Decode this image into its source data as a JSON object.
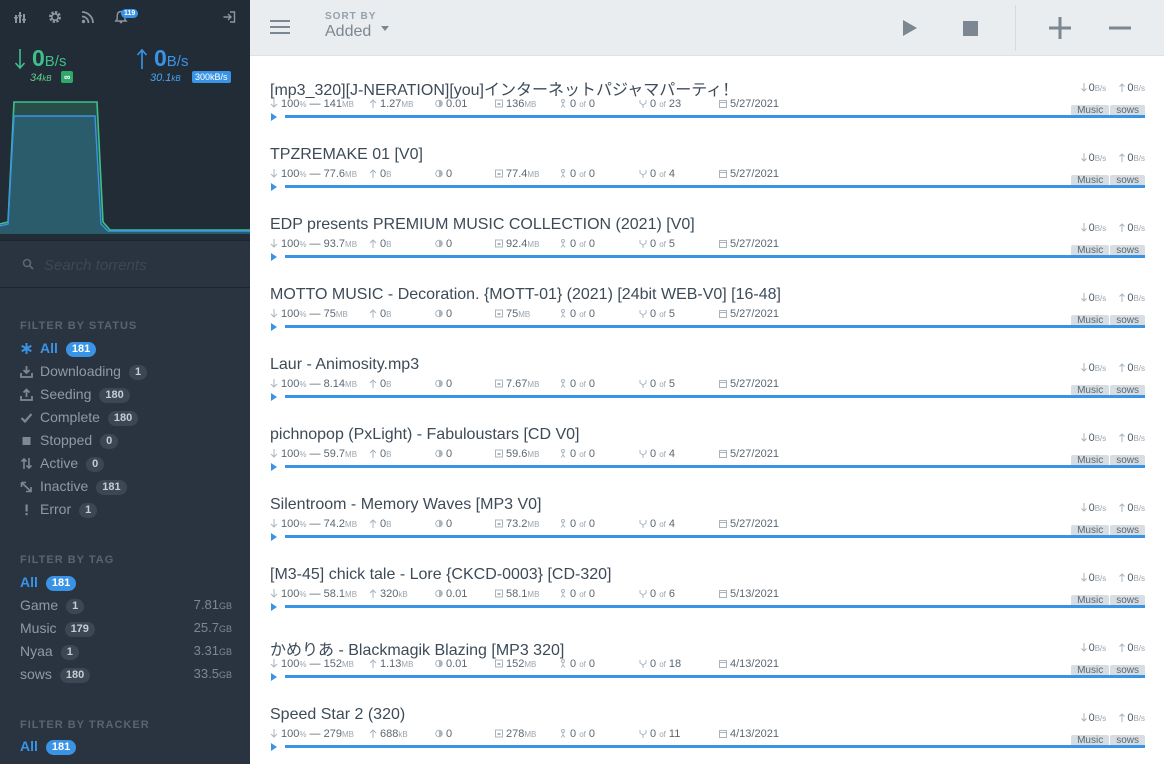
{
  "sidebar": {
    "icons": [
      "stats-icon",
      "settings-icon",
      "feed-icon",
      "notifications-icon",
      "logout-icon"
    ],
    "notification_count": "119",
    "download": {
      "value": "0",
      "unit": "B/s",
      "total": "34",
      "total_unit": "kB",
      "limit": "∞"
    },
    "upload": {
      "value": "0",
      "unit": "B/s",
      "total": "30.1",
      "total_unit": "kB",
      "limit": "300kB/s"
    },
    "search_placeholder": "Search torrents",
    "status_heading": "FILTER BY STATUS",
    "statuses": [
      {
        "label": "All",
        "count": "181",
        "icon": "asterisk-icon",
        "active": true
      },
      {
        "label": "Downloading",
        "count": "1",
        "icon": "download-icon",
        "active": false
      },
      {
        "label": "Seeding",
        "count": "180",
        "icon": "upload-icon",
        "active": false
      },
      {
        "label": "Complete",
        "count": "180",
        "icon": "check-icon",
        "active": false
      },
      {
        "label": "Stopped",
        "count": "0",
        "icon": "stop-icon",
        "active": false
      },
      {
        "label": "Active",
        "count": "0",
        "icon": "swap-icon",
        "active": false
      },
      {
        "label": "Inactive",
        "count": "181",
        "icon": "inactive-icon",
        "active": false
      },
      {
        "label": "Error",
        "count": "1",
        "icon": "exclamation-icon",
        "active": false
      }
    ],
    "tag_heading": "FILTER BY TAG",
    "tags": [
      {
        "label": "All",
        "count": "181",
        "size": "",
        "unit": "",
        "active": true
      },
      {
        "label": "Game",
        "count": "1",
        "size": "7.81",
        "unit": "GB",
        "active": false
      },
      {
        "label": "Music",
        "count": "179",
        "size": "25.7",
        "unit": "GB",
        "active": false
      },
      {
        "label": "Nyaa",
        "count": "1",
        "size": "3.31",
        "unit": "GB",
        "active": false
      },
      {
        "label": "sows",
        "count": "180",
        "size": "33.5",
        "unit": "GB",
        "active": false
      }
    ],
    "tracker_heading": "FILTER BY TRACKER",
    "trackers": [
      {
        "label": "All",
        "count": "181",
        "active": true
      }
    ]
  },
  "toolbar": {
    "sort_label": "SORT BY",
    "sort_value": "Added",
    "icons": [
      "menu-icon",
      "start-icon",
      "stop-icon",
      "add-icon",
      "remove-icon"
    ]
  },
  "colors": {
    "accent": "#3a94e6",
    "download": "#3fbf8a",
    "sidebar": "#2a3440"
  },
  "torrents": [
    {
      "name": "[mp3_320][J-NERATION][you]インターネットパジャマパーティ！",
      "percent": "100",
      "size": "141",
      "size_unit": "MB",
      "uploaded": "1.27",
      "uploaded_unit": "MB",
      "ratio": "0.01",
      "downloaded": "136",
      "downloaded_unit": "MB",
      "peers": "0",
      "peers_of": "0",
      "seeds": "0",
      "seeds_of": "23",
      "date": "5/27/2021",
      "dl_rate": "0",
      "ul_rate": "0",
      "rate_unit": "B/s",
      "tags": [
        "Music",
        "sows"
      ],
      "progress": 100
    },
    {
      "name": "TPZREMAKE 01 [V0]",
      "percent": "100",
      "size": "77.6",
      "size_unit": "MB",
      "uploaded": "0",
      "uploaded_unit": "B",
      "ratio": "0",
      "downloaded": "77.4",
      "downloaded_unit": "MB",
      "peers": "0",
      "peers_of": "0",
      "seeds": "0",
      "seeds_of": "4",
      "date": "5/27/2021",
      "dl_rate": "0",
      "ul_rate": "0",
      "rate_unit": "B/s",
      "tags": [
        "Music",
        "sows"
      ],
      "progress": 100
    },
    {
      "name": "EDP presents PREMIUM MUSIC COLLECTION (2021) [V0]",
      "percent": "100",
      "size": "93.7",
      "size_unit": "MB",
      "uploaded": "0",
      "uploaded_unit": "B",
      "ratio": "0",
      "downloaded": "92.4",
      "downloaded_unit": "MB",
      "peers": "0",
      "peers_of": "0",
      "seeds": "0",
      "seeds_of": "5",
      "date": "5/27/2021",
      "dl_rate": "0",
      "ul_rate": "0",
      "rate_unit": "B/s",
      "tags": [
        "Music",
        "sows"
      ],
      "progress": 100
    },
    {
      "name": "MOTTO MUSIC - Decoration. {MOTT-01} (2021) [24bit WEB-V0] [16-48]",
      "percent": "100",
      "size": "75",
      "size_unit": "MB",
      "uploaded": "0",
      "uploaded_unit": "B",
      "ratio": "0",
      "downloaded": "75",
      "downloaded_unit": "MB",
      "peers": "0",
      "peers_of": "0",
      "seeds": "0",
      "seeds_of": "5",
      "date": "5/27/2021",
      "dl_rate": "0",
      "ul_rate": "0",
      "rate_unit": "B/s",
      "tags": [
        "Music",
        "sows"
      ],
      "progress": 100
    },
    {
      "name": "Laur - Animosity.mp3",
      "percent": "100",
      "size": "8.14",
      "size_unit": "MB",
      "uploaded": "0",
      "uploaded_unit": "B",
      "ratio": "0",
      "downloaded": "7.67",
      "downloaded_unit": "MB",
      "peers": "0",
      "peers_of": "0",
      "seeds": "0",
      "seeds_of": "5",
      "date": "5/27/2021",
      "dl_rate": "0",
      "ul_rate": "0",
      "rate_unit": "B/s",
      "tags": [
        "Music",
        "sows"
      ],
      "progress": 100
    },
    {
      "name": "pichnopop (PxLight) - Fabuloustars [CD V0]",
      "percent": "100",
      "size": "59.7",
      "size_unit": "MB",
      "uploaded": "0",
      "uploaded_unit": "B",
      "ratio": "0",
      "downloaded": "59.6",
      "downloaded_unit": "MB",
      "peers": "0",
      "peers_of": "0",
      "seeds": "0",
      "seeds_of": "4",
      "date": "5/27/2021",
      "dl_rate": "0",
      "ul_rate": "0",
      "rate_unit": "B/s",
      "tags": [
        "Music",
        "sows"
      ],
      "progress": 100
    },
    {
      "name": "Silentroom - Memory Waves [MP3 V0]",
      "percent": "100",
      "size": "74.2",
      "size_unit": "MB",
      "uploaded": "0",
      "uploaded_unit": "B",
      "ratio": "0",
      "downloaded": "73.2",
      "downloaded_unit": "MB",
      "peers": "0",
      "peers_of": "0",
      "seeds": "0",
      "seeds_of": "4",
      "date": "5/27/2021",
      "dl_rate": "0",
      "ul_rate": "0",
      "rate_unit": "B/s",
      "tags": [
        "Music",
        "sows"
      ],
      "progress": 100
    },
    {
      "name": "[M3-45] chick tale - Lore {CKCD-0003} [CD-320]",
      "percent": "100",
      "size": "58.1",
      "size_unit": "MB",
      "uploaded": "320",
      "uploaded_unit": "kB",
      "ratio": "0.01",
      "downloaded": "58.1",
      "downloaded_unit": "MB",
      "peers": "0",
      "peers_of": "0",
      "seeds": "0",
      "seeds_of": "6",
      "date": "5/13/2021",
      "dl_rate": "0",
      "ul_rate": "0",
      "rate_unit": "B/s",
      "tags": [
        "Music",
        "sows"
      ],
      "progress": 100
    },
    {
      "name": "かめりあ - Blackmagik Blazing [MP3 320]",
      "percent": "100",
      "size": "152",
      "size_unit": "MB",
      "uploaded": "1.13",
      "uploaded_unit": "MB",
      "ratio": "0.01",
      "downloaded": "152",
      "downloaded_unit": "MB",
      "peers": "0",
      "peers_of": "0",
      "seeds": "0",
      "seeds_of": "18",
      "date": "4/13/2021",
      "dl_rate": "0",
      "ul_rate": "0",
      "rate_unit": "B/s",
      "tags": [
        "Music",
        "sows"
      ],
      "progress": 100
    },
    {
      "name": "Speed Star 2 (320)",
      "percent": "100",
      "size": "279",
      "size_unit": "MB",
      "uploaded": "688",
      "uploaded_unit": "kB",
      "ratio": "0",
      "downloaded": "278",
      "downloaded_unit": "MB",
      "peers": "0",
      "peers_of": "0",
      "seeds": "0",
      "seeds_of": "11",
      "date": "4/13/2021",
      "dl_rate": "0",
      "ul_rate": "0",
      "rate_unit": "B/s",
      "tags": [
        "Music",
        "sows"
      ],
      "progress": 100
    }
  ]
}
